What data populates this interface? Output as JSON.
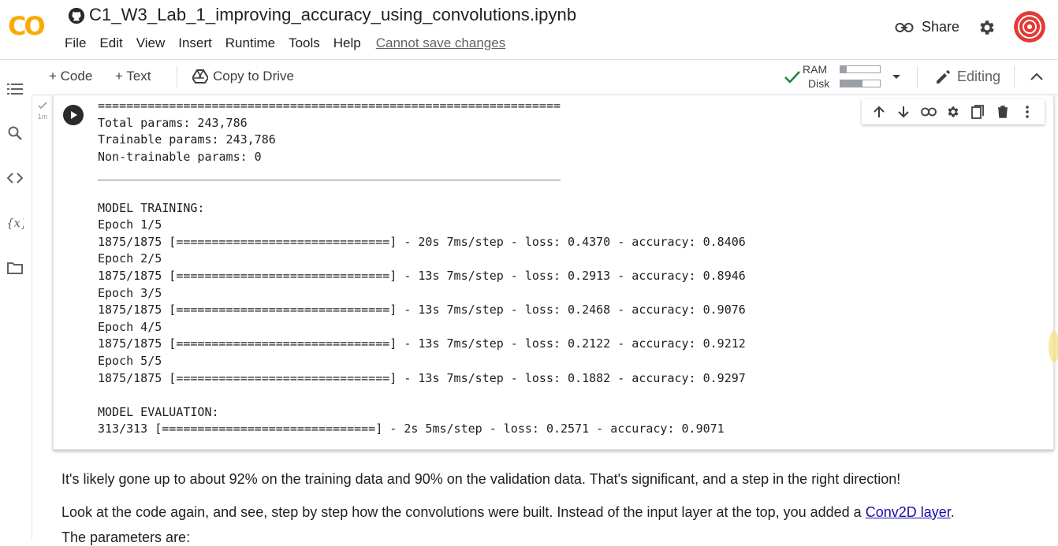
{
  "app": {
    "title": "C1_W3_Lab_1_improving_accuracy_using_convolutions.ipynb",
    "logo_text": "CO",
    "menu": [
      "File",
      "Edit",
      "View",
      "Insert",
      "Runtime",
      "Tools",
      "Help"
    ],
    "save_notice": "Cannot save changes",
    "share_label": "Share"
  },
  "toolbar": {
    "add_code": "+ Code",
    "add_text": "+ Text",
    "copy_to_drive": "Copy to Drive",
    "ram_label": "RAM",
    "disk_label": "Disk",
    "ram_usage": 0.15,
    "disk_usage": 0.55,
    "editing_label": "Editing"
  },
  "cell": {
    "exec_time": "1m",
    "output_lines": [
      "=================================================================",
      "Total params: 243,786",
      "Trainable params: 243,786",
      "Non-trainable params: 0",
      "_________________________________________________________________",
      "",
      "MODEL TRAINING:",
      "Epoch 1/5",
      "1875/1875 [==============================] - 20s 7ms/step - loss: 0.4370 - accuracy: 0.8406",
      "Epoch 2/5",
      "1875/1875 [==============================] - 13s 7ms/step - loss: 0.2913 - accuracy: 0.8946",
      "Epoch 3/5",
      "1875/1875 [==============================] - 13s 7ms/step - loss: 0.2468 - accuracy: 0.9076",
      "Epoch 4/5",
      "1875/1875 [==============================] - 13s 7ms/step - loss: 0.2122 - accuracy: 0.9212",
      "Epoch 5/5",
      "1875/1875 [==============================] - 13s 7ms/step - loss: 0.1882 - accuracy: 0.9297",
      "",
      "MODEL EVALUATION:",
      "313/313 [==============================] - 2s 5ms/step - loss: 0.2571 - accuracy: 0.9071"
    ]
  },
  "markdown": {
    "para1": "It's likely gone up to about 92% on the training data and 90% on the validation data. That's significant, and a step in the right direction!",
    "para2_prefix": "Look at the code again, and see, step by step how the convolutions were built. Instead of the input layer at the top, you added a ",
    "para2_link": "Conv2D layer",
    "para2_suffix": ".",
    "para3": "The parameters are:"
  },
  "colors": {
    "logo_orange": "#F9AB00",
    "logo_orange_dark": "#E8710A",
    "avatar_red": "#E53935",
    "link": "#1a0dab",
    "check_green": "#188038"
  }
}
